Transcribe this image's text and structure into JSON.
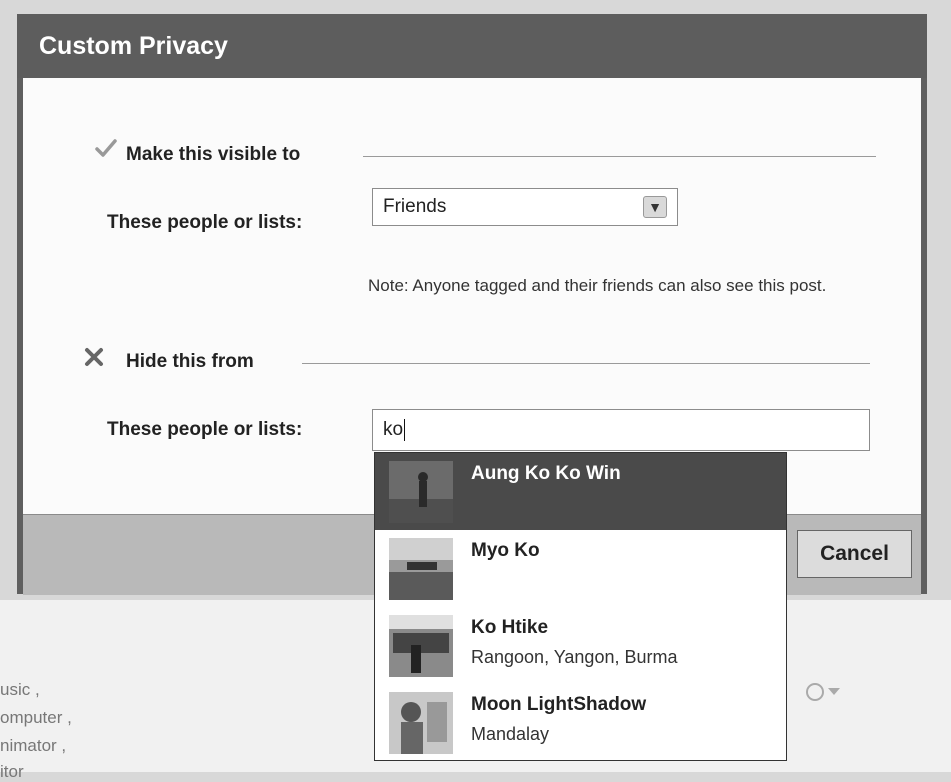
{
  "dialog": {
    "title": "Custom Privacy",
    "cancel_label": "Cancel"
  },
  "visible_section": {
    "icon": "checkmark-icon",
    "title": "Make this visible to",
    "field_label": "These people or lists:",
    "selected_value": "Friends",
    "note": "Note: Anyone tagged and their friends can also see this post."
  },
  "hide_section": {
    "icon": "cross-icon",
    "title": "Hide this from",
    "field_label": "These people or lists:",
    "input_value": "ko"
  },
  "suggestions": [
    {
      "name": "Aung Ko Ko Win",
      "location": "",
      "selected": true
    },
    {
      "name": "Myo Ko",
      "location": "",
      "selected": false
    },
    {
      "name": "Ko Htike",
      "location": "Rangoon, Yangon, Burma",
      "selected": false
    },
    {
      "name": "Moon LightShadow",
      "location": "Mandalay",
      "selected": false
    }
  ],
  "background": {
    "fragments": [
      "usic ,",
      "omputer ,",
      "nimator ,",
      "itor"
    ]
  },
  "colors": {
    "title_bar": "#5d5d5d",
    "selected_row": "#4a4a4a",
    "footer": "#b9b9b9"
  }
}
